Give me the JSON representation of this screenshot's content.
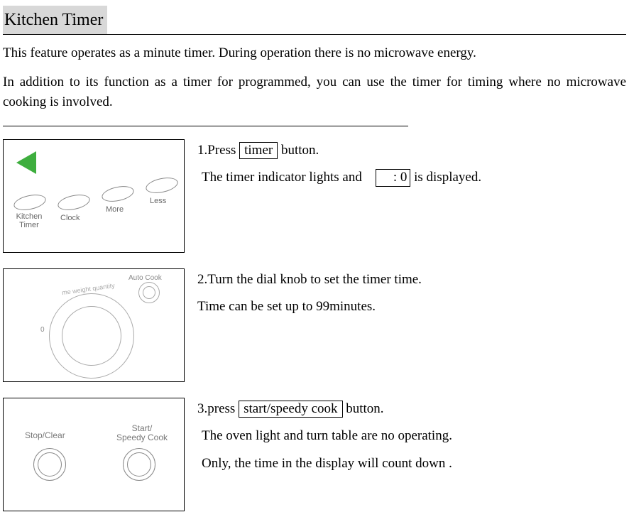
{
  "title": "Kitchen Timer",
  "intro": {
    "p1": "This feature operates as a minute timer. During operation there is no microwave energy.",
    "p2": "In addition to its function as a timer for programmed, you can use the timer for timing where no microwave cooking is involved."
  },
  "step1": {
    "line1_before": "1.Press ",
    "button": "timer",
    "line1_after": " button.",
    "line2_before": "The timer indicator lights and ",
    "display": ": 0",
    "line2_after": " is displayed.",
    "fig": {
      "kitchen_timer": "Kitchen\nTimer",
      "clock": "Clock",
      "more": "More",
      "less": "Less"
    }
  },
  "step2": {
    "line1": "2.Turn the dial knob to set the timer time.",
    "line2": "Time can be set up to 99minutes.",
    "fig": {
      "auto_cook": "Auto Cook",
      "arc": "me weight quantity",
      "zero": "0"
    }
  },
  "step3": {
    "line1_before": "3.press ",
    "button": "start/speedy cook",
    "line1_after": " button.",
    "line2": "The oven light and turn table are no operating.",
    "line3": "Only, the time in the display will count down .",
    "fig": {
      "stop_clear": "Stop/Clear",
      "start_speedy": "Start/\nSpeedy Cook"
    }
  }
}
